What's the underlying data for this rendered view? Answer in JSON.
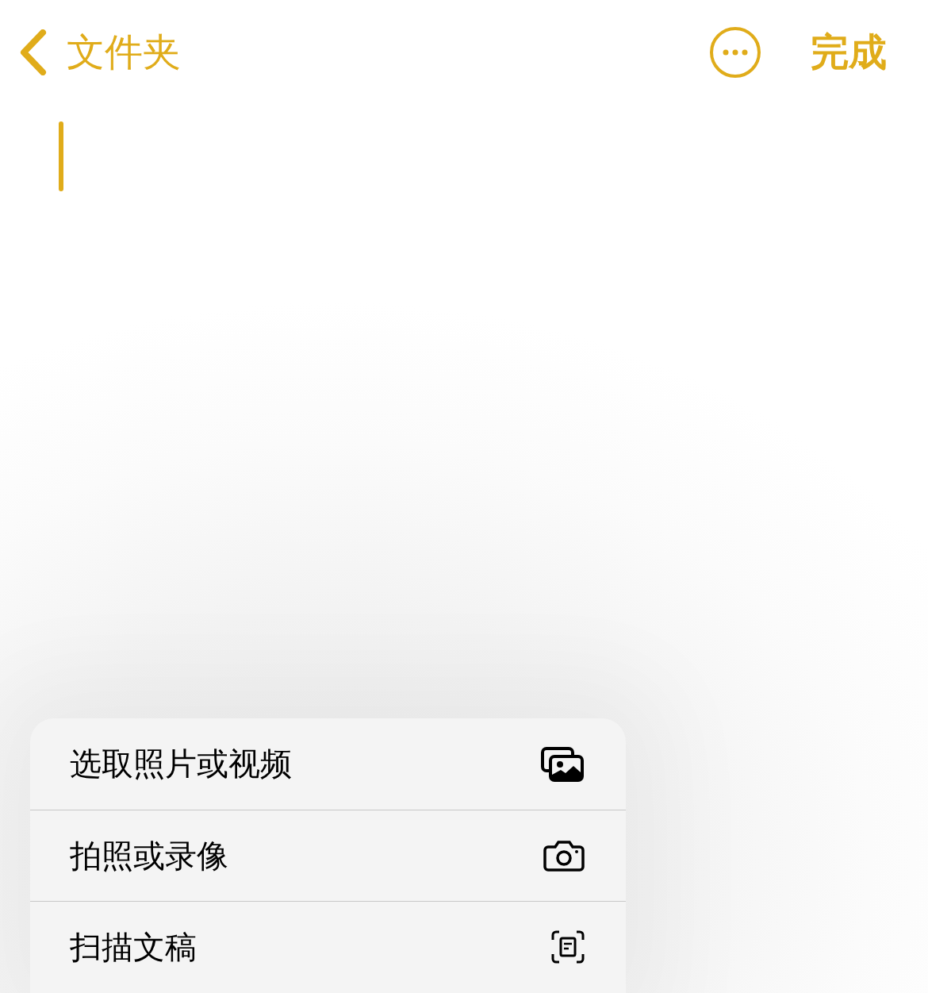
{
  "nav": {
    "back_label": "文件夹",
    "done_label": "完成"
  },
  "menu": {
    "items": [
      {
        "label": "选取照片或视频",
        "kind": "photos"
      },
      {
        "label": "拍照或录像",
        "kind": "camera"
      },
      {
        "label": "扫描文稿",
        "kind": "scan"
      }
    ]
  }
}
